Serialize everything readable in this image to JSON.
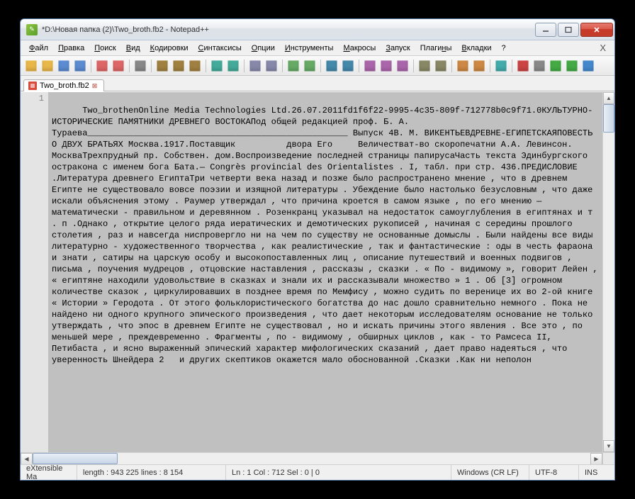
{
  "titlebar": {
    "title": "*D:\\Новая папка (2)\\Two_broth.fb2 - Notepad++"
  },
  "menu": {
    "items": [
      {
        "label": "Файл",
        "u": 0
      },
      {
        "label": "Правка",
        "u": 0
      },
      {
        "label": "Поиск",
        "u": 0
      },
      {
        "label": "Вид",
        "u": 0
      },
      {
        "label": "Кодировки",
        "u": 0
      },
      {
        "label": "Синтаксисы",
        "u": 0
      },
      {
        "label": "Опции",
        "u": 0
      },
      {
        "label": "Инструменты",
        "u": 0
      },
      {
        "label": "Макросы",
        "u": 0
      },
      {
        "label": "Запуск",
        "u": 0
      },
      {
        "label": "Плагины",
        "u": 5
      },
      {
        "label": "Вкладки",
        "u": 0
      },
      {
        "label": "?",
        "u": 0
      }
    ],
    "x_label": "X"
  },
  "toolbar": {
    "groups": [
      [
        "new-file-icon",
        "open-file-icon",
        "save-icon",
        "save-all-icon"
      ],
      [
        "close-tab-icon",
        "close-all-icon"
      ],
      [
        "print-icon"
      ],
      [
        "cut-icon",
        "copy-icon",
        "paste-icon"
      ],
      [
        "undo-icon",
        "redo-icon"
      ],
      [
        "find-icon",
        "replace-icon"
      ],
      [
        "zoom-in-icon",
        "zoom-out-icon"
      ],
      [
        "sync-v-icon",
        "sync-h-icon"
      ],
      [
        "wrap-icon",
        "all-chars-icon",
        "indent-guide-icon"
      ],
      [
        "lang-icon",
        "doc-map-icon"
      ],
      [
        "function-list-icon",
        "folder-icon"
      ],
      [
        "monitor-icon"
      ],
      [
        "record-macro-icon",
        "stop-macro-icon",
        "play-macro-icon",
        "play-multi-icon",
        "save-macro-icon"
      ]
    ]
  },
  "tab": {
    "label": "Two_broth.fb2"
  },
  "editor": {
    "gutter_line": "1",
    "content": "Two_brothenOnline Media Technologies Ltd.26.07.2011fd1f6f22-9995-4c35-809f-712778b0c9f71.0КУЛЬТУРНО-ИСТОРИЧЕСКИЕ ПАМЯТНИКИ ДРЕВНЕГО ВОСТОКАПод общей редакцией проф. Б. А. Тураева___________________________________________________ Выпуск 4В. М. ВИКЕНТЬЕВДРЕВНЕ-ЕГИПЕТСКАЯПОВЕСТЬ О ДВУХ БРАТЬЯХ Москва.1917.Поставщик          двора Его     Величестват-во скоропечатни А.А. Левинсон. МоскваТрехпрудный пр. Собствен. дом.Воспроизведение последней страницы папирусаЧасть текста Эдинбургского остракона с именем бога Бата.— Congrès provincial des Orientalistes . I, табл. при стр. 436.ПРЕДИСЛОВИЕ .Литература древнего ЕгиптаТри четверти века назад и позже было распространено мнение , что в древнем Египте не существовало вовсе поэзии и изящной литературы . Убеждение было настолько безусловным , что даже искали объяснения этому . Раумер утверждал , что причина кроется в самом языке , по его мнению — математически - правильном и деревянном . Розенкранц указывал на недостаток самоуглубления в египтянах и т . п .Однако , открытие целого ряда иератических и демотических рукописей , начиная с середины прошлого столетия , раз и навсегда ниспровергло ни на чем по существу не основанные домыслы . Были найдены все виды литературно - художественного творчества , как реалистические , так и фантастические : оды в честь фараона и знати , сатиры на царскую особу и высокопоставленных лиц , описание путешествий и военных подвигов , письма , поучения мудрецов , отцовские наставления , рассказы , сказки . « По - видимому », говорит Лейен , « египтяне находили удовольствие в сказках и знали их и рассказывали множество » 1 . Об [3] огромном количестве сказок , циркулировавших в позднее время по Мемфису , можно судить по веренице их во 2-ой книге « Истории » Геродота . От этого фольклористического богатства до нас дошло сравнительно немного . Пока не найдено ни одного крупного эпического произведения , что дает некоторым исследователям основание не только утверждать , что эпос в древнем Египте не существовал , но и искать причины этого явления . Все это , по меньшей мере , преждевременно . Фрагменты , по - видимому , обширных циклов , как - то Рамсеса II, Петибаста , и ясно выраженный эпический характер мифологических сказаний , дает право надеяться , что уверенность Шнейдера 2   и других скептиков окажется мало обоснованной .Сказки .Как ни неполон"
  },
  "status": {
    "lang": "eXtensible Ma",
    "length": "length : 943 225    lines : 8 154",
    "pos": "Ln : 1    Col : 712    Sel : 0 | 0",
    "eol": "Windows (CR LF)",
    "encoding": "UTF-8",
    "mode": "INS"
  },
  "icon_colors": {
    "new-file-icon": "#e8b74a",
    "open-file-icon": "#e8b74a",
    "save-icon": "#5b8bd0",
    "save-all-icon": "#5b8bd0",
    "close-tab-icon": "#d66",
    "close-all-icon": "#d66",
    "print-icon": "#888",
    "cut-icon": "#a08040",
    "copy-icon": "#a08040",
    "paste-icon": "#a08040",
    "undo-icon": "#4a9",
    "redo-icon": "#4a9",
    "find-icon": "#88a",
    "replace-icon": "#88a",
    "zoom-in-icon": "#6a6",
    "zoom-out-icon": "#6a6",
    "sync-v-icon": "#48a",
    "sync-h-icon": "#48a",
    "wrap-icon": "#a6a",
    "all-chars-icon": "#a6a",
    "indent-guide-icon": "#a6a",
    "lang-icon": "#886",
    "doc-map-icon": "#886",
    "function-list-icon": "#c84",
    "folder-icon": "#c84",
    "monitor-icon": "#4aa",
    "record-macro-icon": "#c44",
    "stop-macro-icon": "#888",
    "play-macro-icon": "#4a4",
    "play-multi-icon": "#4a4",
    "save-macro-icon": "#48c"
  }
}
